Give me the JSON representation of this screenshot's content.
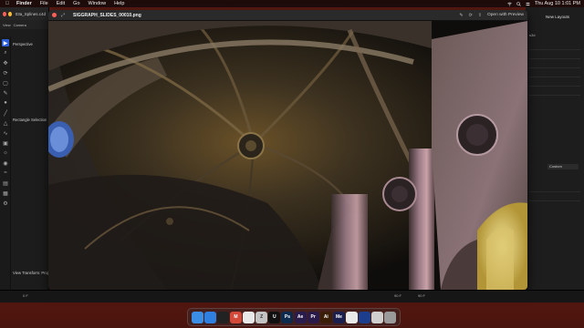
{
  "menubar": {
    "apple_icon": "apple-icon",
    "items": [
      "Finder",
      "File",
      "Edit",
      "Go",
      "Window",
      "Help"
    ],
    "clock": "Thu Aug 10  1:01 PM"
  },
  "left_app": {
    "title": "03a_Splines.c4d",
    "tabs": [
      "View",
      "Camera"
    ],
    "labels": {
      "perspective": "Perspective",
      "rectangle_selection": "Rectangle Selection",
      "view_transform": "View Transform: Proje"
    },
    "frame_readout": "0 F"
  },
  "right_app": {
    "new_layouts": "New Layouts",
    "top_readout": "s3d",
    "custom_select": "Custom"
  },
  "preview": {
    "filename": "SIGGRAPH_SLIDES_00010.png",
    "open_with": "Open with Preview"
  },
  "timeline": {
    "start": "0 F",
    "marks": [
      "90 F",
      "90 F"
    ]
  },
  "dock": {
    "apps": [
      {
        "name": "finder-icon",
        "label": "",
        "color": "#3a8ee6"
      },
      {
        "name": "safari-icon",
        "label": "",
        "color": "#2f7fe0"
      },
      {
        "name": "terminal-icon",
        "label": "",
        "color": "#222222"
      },
      {
        "name": "gmail-icon",
        "label": "M",
        "color": "#d44a3a"
      },
      {
        "name": "chrome-icon",
        "label": "",
        "color": "#e8e8e8"
      },
      {
        "name": "zbrush-icon",
        "label": "Z",
        "color": "#c3c3c3"
      },
      {
        "name": "unreal-icon",
        "label": "U",
        "color": "#111111"
      },
      {
        "name": "photoshop-icon",
        "label": "Ps",
        "color": "#0e2a4d"
      },
      {
        "name": "after-effects-icon",
        "label": "Ae",
        "color": "#2a1b4d"
      },
      {
        "name": "premiere-icon",
        "label": "Pr",
        "color": "#2a1a4a"
      },
      {
        "name": "illustrator-icon",
        "label": "Ai",
        "color": "#3b1e08"
      },
      {
        "name": "media-encoder-icon",
        "label": "Me",
        "color": "#1b1f4d"
      },
      {
        "name": "preview-icon",
        "label": "",
        "color": "#eaeaea"
      },
      {
        "name": "cinema4d-icon",
        "label": "",
        "color": "#1c3e8c"
      },
      {
        "name": "screenshot-icon",
        "label": "",
        "color": "#cfcfcf"
      },
      {
        "name": "trash-icon",
        "label": "",
        "color": "#9a9a9a"
      }
    ]
  }
}
